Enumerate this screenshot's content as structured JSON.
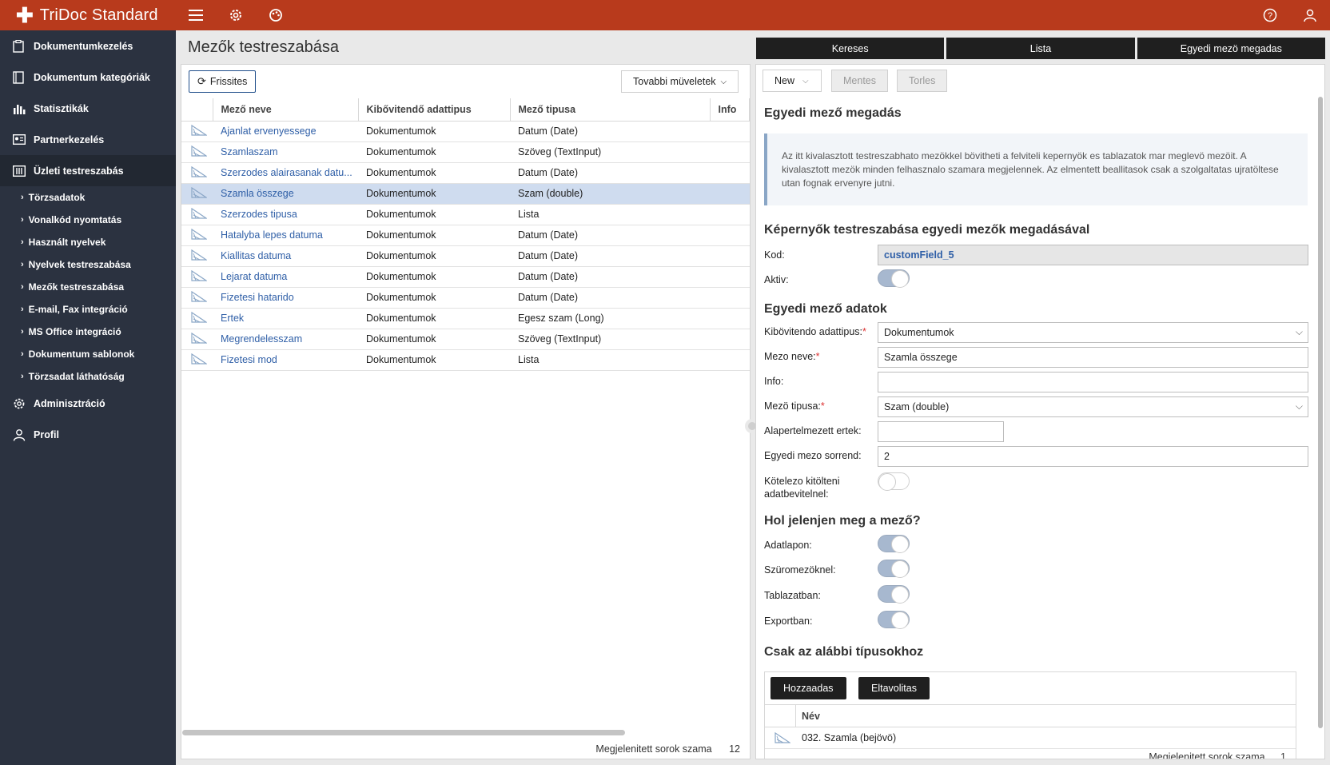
{
  "app": {
    "title": "TriDoc Standard"
  },
  "topbar": {
    "icons": [
      "menu-icon",
      "gear-icon",
      "palette-icon",
      "help-icon",
      "user-icon"
    ]
  },
  "sidebar": {
    "items": [
      {
        "label": "Dokumentumkezelés",
        "icon": "clipboard-icon"
      },
      {
        "label": "Dokumentum kategóriák",
        "icon": "book-icon"
      },
      {
        "label": "Statisztikák",
        "icon": "chart-icon"
      },
      {
        "label": "Partnerkezelés",
        "icon": "idcard-icon"
      },
      {
        "label": "Üzleti testreszabás",
        "icon": "sliders-icon"
      }
    ],
    "subitems": [
      "Törzsadatok",
      "Vonalkód nyomtatás",
      "Használt nyelvek",
      "Nyelvek testreszabása",
      "Mezők testreszabása",
      "E-mail, Fax integráció",
      "MS Office integráció",
      "Dokumentum sablonok",
      "Törzsadat láthatóság"
    ],
    "bottom": [
      {
        "label": "Adminisztráció",
        "icon": "gear-icon"
      },
      {
        "label": "Profil",
        "icon": "user-icon"
      }
    ]
  },
  "left": {
    "title": "Mezők testreszabása",
    "refresh_label": "Frissites",
    "more_label": "Tovabbi müveletek",
    "columns": [
      "Mező neve",
      "Kibővitendő adattipus",
      "Mező tipusa",
      "Info"
    ],
    "rows": [
      [
        "Ajanlat ervenyessege",
        "Dokumentumok",
        "Datum (Date)"
      ],
      [
        "Szamlaszam",
        "Dokumentumok",
        "Szöveg (TextInput)"
      ],
      [
        "Szerzodes alairasanak datu...",
        "Dokumentumok",
        "Datum (Date)"
      ],
      [
        "Szamla összege",
        "Dokumentumok",
        "Szam (double)"
      ],
      [
        "Szerzodes tipusa",
        "Dokumentumok",
        "Lista"
      ],
      [
        "Hatalyba lepes datuma",
        "Dokumentumok",
        "Datum (Date)"
      ],
      [
        "Kiallitas datuma",
        "Dokumentumok",
        "Datum (Date)"
      ],
      [
        "Lejarat datuma",
        "Dokumentumok",
        "Datum (Date)"
      ],
      [
        "Fizetesi hatarido",
        "Dokumentumok",
        "Datum (Date)"
      ],
      [
        "Ertek",
        "Dokumentumok",
        "Egesz szam (Long)"
      ],
      [
        "Megrendelesszam",
        "Dokumentumok",
        "Szöveg (TextInput)"
      ],
      [
        "Fizetesi mod",
        "Dokumentumok",
        "Lista"
      ]
    ],
    "footer_label": "Megjelenitett sorok szama",
    "footer_count": "12"
  },
  "right": {
    "tabs": [
      "Kereses",
      "Lista",
      "Egyedi mezö megadas"
    ],
    "buttons": {
      "new": "New",
      "save": "Mentes",
      "delete": "Torles"
    },
    "h1": "Egyedi mező megadás",
    "info_text": "Az itt kivalasztott testreszabhato mezökkel bövitheti a felviteli kepernyök es tablazatok mar meglevö mezöit. A kivalasztott mezök minden felhasznalo szamara megjelennek. Az elmentett beallitasok csak a szolgaltatas ujratöltese utan fognak ervenyre jutni.",
    "h2": "Képernyők testreszabása egyedi mezők megadásával",
    "kod_label": "Kod:",
    "kod_value": "customField_5",
    "aktiv_label": "Aktiv:",
    "h3": "Egyedi mező adatok",
    "f_adattipus_label": "Kibövitendo adattipus:",
    "f_adattipus_value": "Dokumentumok",
    "f_nev_label": "Mezo neve:",
    "f_nev_value": "Szamla összege",
    "f_info_label": "Info:",
    "f_info_value": "",
    "f_tipus_label": "Mezö tipusa:",
    "f_tipus_value": "Szam (double)",
    "f_alap_label": "Alapertelmezett ertek:",
    "f_alap_value": "",
    "f_sorrend_label": "Egyedi mezo sorrend:",
    "f_sorrend_value": "2",
    "f_kotelezo_label_1": "Kötelezo kitölteni",
    "f_kotelezo_label_2": "adatbevitelnel:",
    "h4": "Hol jelenjen meg a mező?",
    "where": [
      "Adatlapon:",
      "Szüromezöknel:",
      "Tablazatban:",
      "Exportban:"
    ],
    "h5": "Csak az alábbi típusokhoz",
    "add_label": "Hozzaadas",
    "remove_label": "Eltavolitas",
    "sub_col": "Név",
    "sub_rows": [
      "032. Szamla (bejövö)"
    ],
    "sub_footer_label": "Megjelenitett sorok szama",
    "sub_footer_count": "1"
  }
}
